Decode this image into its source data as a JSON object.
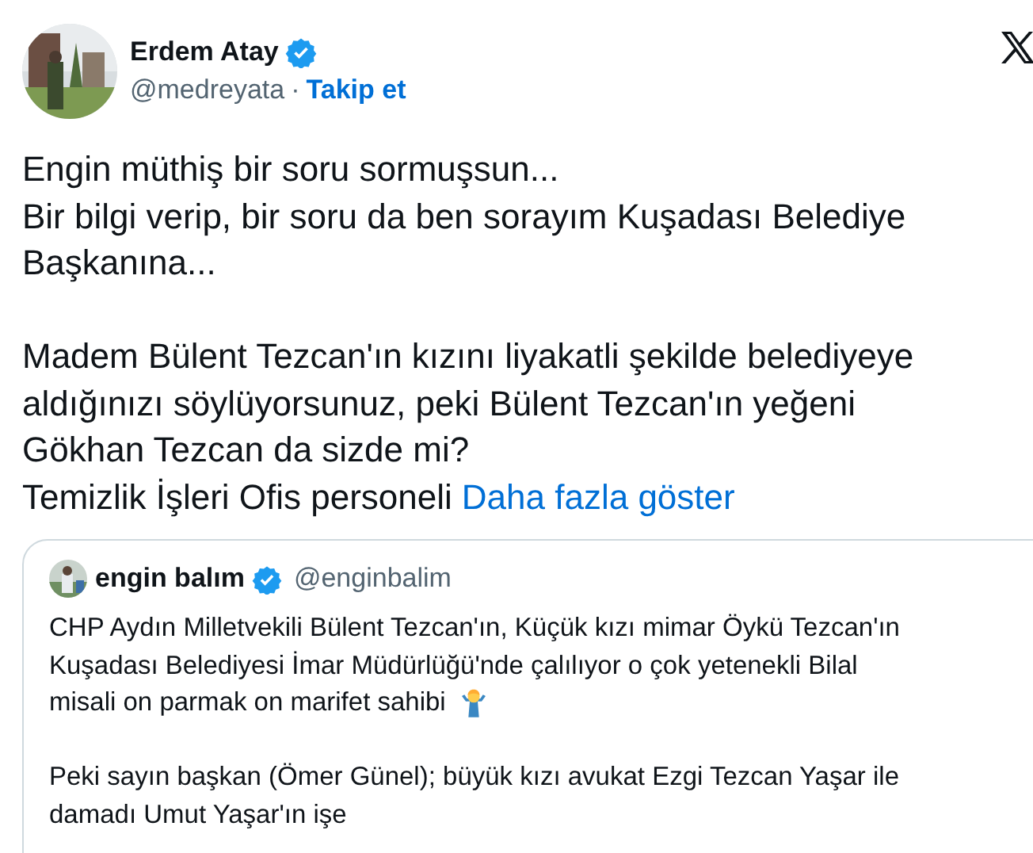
{
  "author": {
    "name": "Erdem Atay",
    "handle": "@medreyata",
    "separator": "·",
    "follow": "Takip et"
  },
  "body": {
    "paragraphs": [
      [
        "Engin müthiş bir soru sormuşsun...",
        "Bir bilgi verip, bir soru da ben sorayım Kuşadası Belediye",
        "Başkanına..."
      ],
      [
        "Madem Bülent Tezcan'ın kızını liyakatli şekilde belediyeye",
        "aldığınızı söylüyorsunuz, peki Bülent Tezcan'ın yeğeni",
        "Gökhan Tezcan da sizde mi?"
      ]
    ],
    "tail": "Temizlik İşleri Ofis personeli",
    "more_link": "Daha fazla göster"
  },
  "quote": {
    "name": "engin balım",
    "handle": "@enginbalim",
    "paragraphs": [
      [
        "CHP Aydın Milletvekili Bülent Tezcan'ın, Küçük kızı mimar Öykü Tezcan'ın",
        "Kuşadası Belediyesi İmar Müdürlüğü'nde çalılıyor o çok yetenekli Bilal",
        "misali on parmak on marifet sahibi"
      ],
      [
        "Peki sayın başkan (Ömer Günel); büyük kızı avukat Ezgi Tezcan Yaşar ile",
        "damadı Umut Yaşar'ın işe"
      ]
    ]
  }
}
